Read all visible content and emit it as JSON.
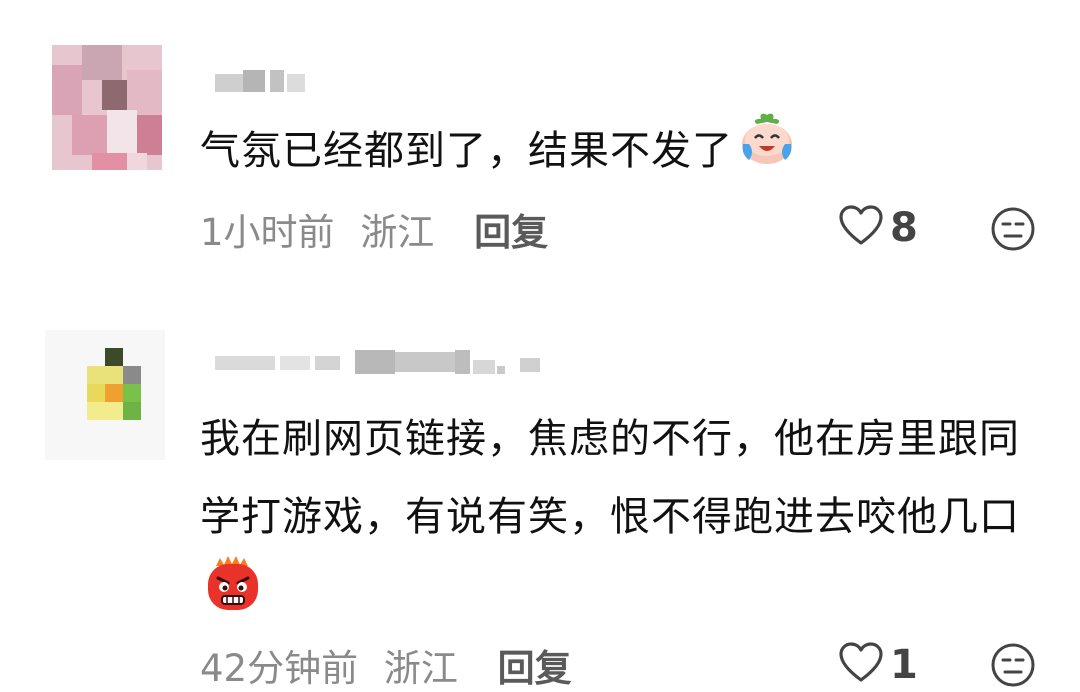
{
  "comments": [
    {
      "text": "气氛已经都到了，结果不发了",
      "emoji": "crying-laughing-bun-emoji",
      "time": "1小时前",
      "location": "浙江",
      "reply_label": "回复",
      "likes": "8"
    },
    {
      "text": "我在刷网页链接，焦虑的不行，他在房里跟同学打游戏，有说有笑，恨不得跑进去咬他几口",
      "emoji": "angry-face-emoji",
      "time": "42分钟前",
      "location": "浙江",
      "reply_label": "回复",
      "likes": "1"
    }
  ],
  "icons": {
    "like": "heart-outline-icon",
    "dislike": "neutral-face-icon"
  },
  "colors": {
    "text": "#111111",
    "meta": "#8a8a8a",
    "reply": "#5a5a5a",
    "icon": "#444444"
  }
}
